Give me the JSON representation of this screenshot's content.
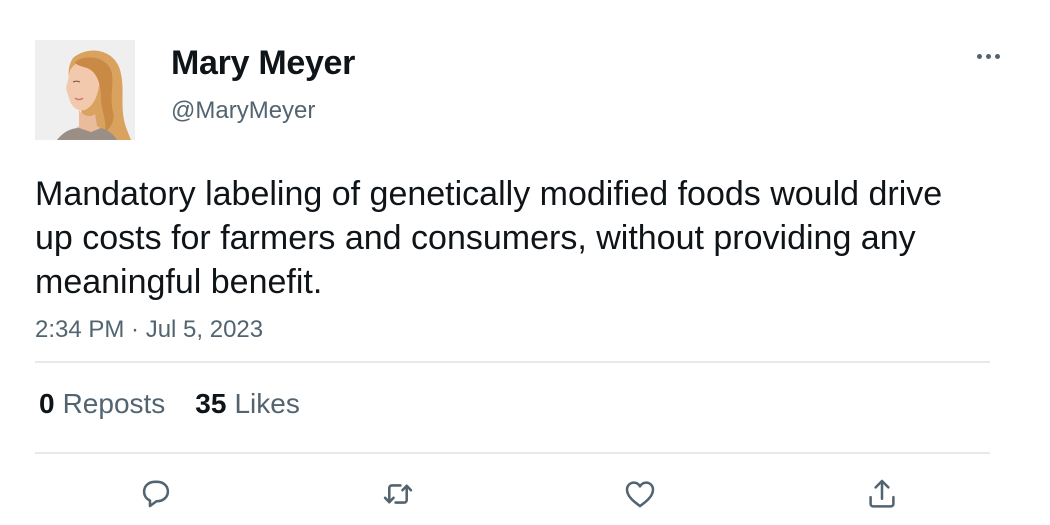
{
  "tweet": {
    "author": {
      "display_name": "Mary Meyer",
      "handle": "@MaryMeyer",
      "avatar_icon": "profile-photo"
    },
    "text": "Mandatory labeling of genetically modified foods would drive up costs for farmers and consumers, without providing any meaningful benefit.",
    "timestamp": "2:34 PM · Jul 5, 2023",
    "stats": {
      "reposts_count": "0",
      "reposts_label": "Reposts",
      "likes_count": "35",
      "likes_label": "Likes"
    },
    "actions": [
      {
        "name": "reply",
        "icon": "speech-bubble-icon"
      },
      {
        "name": "repost",
        "icon": "repost-arrows-icon"
      },
      {
        "name": "like",
        "icon": "heart-icon"
      },
      {
        "name": "share",
        "icon": "share-upload-icon"
      }
    ],
    "colors": {
      "text_primary": "#0f1419",
      "text_secondary": "#536471",
      "divider": "#e7e9ea",
      "background": "#ffffff"
    }
  }
}
